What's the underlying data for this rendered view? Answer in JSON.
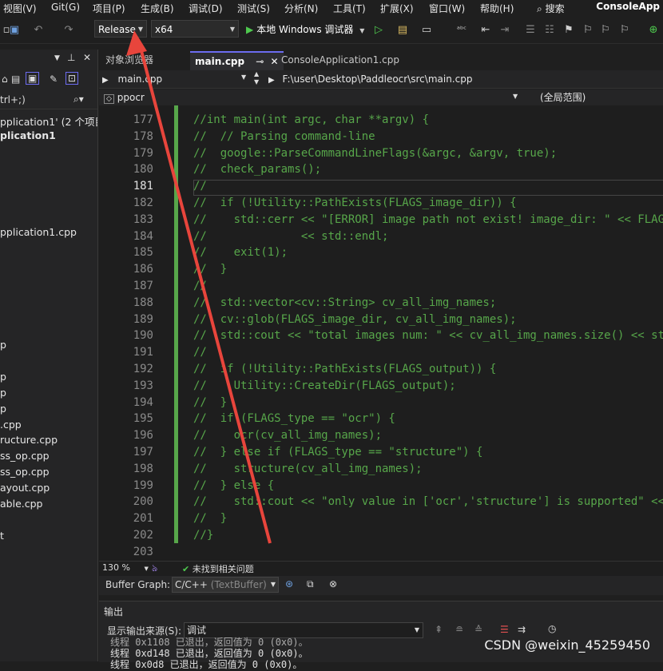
{
  "menu": {
    "items": [
      "视图(V)",
      "Git(G)",
      "项目(P)",
      "生成(B)",
      "调试(D)",
      "测试(S)",
      "分析(N)",
      "工具(T)",
      "扩展(X)",
      "窗口(W)",
      "帮助(H)"
    ],
    "search": "搜索",
    "app_title": "ConsoleApp"
  },
  "toolbar": {
    "config": "Release",
    "platform": "x64",
    "run_label": "本地 Windows 调试器"
  },
  "solution": {
    "search_hint": "trl+;)",
    "rows": [
      "pplication1' (2 个项目",
      "plication1",
      "pplication1.cpp",
      "p",
      "p",
      "p",
      "p",
      ".cpp",
      "ructure.cpp",
      "ss_op.cpp",
      "ss_op.cpp",
      "ayout.cpp",
      "able.cpp",
      "t"
    ]
  },
  "tabs": {
    "object_browser": "对象浏览器",
    "main": "main.cpp",
    "console": "ConsoleApplication1.cpp"
  },
  "nav": {
    "file": "main.cpp",
    "path": "F:\\user\\Desktop\\Paddleocr\\src\\main.cpp",
    "scope_left": "ppocr",
    "scope_right": "(全局范围)"
  },
  "editor": {
    "current_line": "181",
    "lines": [
      {
        "n": "177",
        "t": "//int main(int argc, char **argv) {"
      },
      {
        "n": "178",
        "t": "//  // Parsing command-line"
      },
      {
        "n": "179",
        "t": "//  google::ParseCommandLineFlags(&argc, &argv, true);"
      },
      {
        "n": "180",
        "t": "//  check_params();"
      },
      {
        "n": "181",
        "t": "//"
      },
      {
        "n": "182",
        "t": "//  if (!Utility::PathExists(FLAGS_image_dir)) {"
      },
      {
        "n": "183",
        "t": "//    std::cerr << \"[ERROR] image path not exist! image_dir: \" << FLAG"
      },
      {
        "n": "184",
        "t": "//              << std::endl;"
      },
      {
        "n": "185",
        "t": "//    exit(1);"
      },
      {
        "n": "186",
        "t": "//  }"
      },
      {
        "n": "187",
        "t": "//"
      },
      {
        "n": "188",
        "t": "//  std::vector<cv::String> cv_all_img_names;"
      },
      {
        "n": "189",
        "t": "//  cv::glob(FLAGS_image_dir, cv_all_img_names);"
      },
      {
        "n": "190",
        "t": "//  std::cout << \"total images num: \" << cv_all_img_names.size() << st"
      },
      {
        "n": "191",
        "t": "//"
      },
      {
        "n": "192",
        "t": "//  if (!Utility::PathExists(FLAGS_output)) {"
      },
      {
        "n": "193",
        "t": "//    Utility::CreateDir(FLAGS_output);"
      },
      {
        "n": "194",
        "t": "//  }"
      },
      {
        "n": "195",
        "t": "//  if (FLAGS_type == \"ocr\") {"
      },
      {
        "n": "196",
        "t": "//    ocr(cv_all_img_names);"
      },
      {
        "n": "197",
        "t": "//  } else if (FLAGS_type == \"structure\") {"
      },
      {
        "n": "198",
        "t": "//    structure(cv_all_img_names);"
      },
      {
        "n": "199",
        "t": "//  } else {"
      },
      {
        "n": "200",
        "t": "//    std::cout << \"only value in ['ocr','structure'] is supported\" <<"
      },
      {
        "n": "201",
        "t": "//  }"
      },
      {
        "n": "202",
        "t": "//}"
      },
      {
        "n": "203",
        "t": ""
      }
    ]
  },
  "status": {
    "zoom": "130 %",
    "issues": "未找到相关问题"
  },
  "buffer": {
    "label": "Buffer Graph:",
    "value": "C/C++",
    "value_hint": "(TextBuffer)"
  },
  "output": {
    "title": "输出",
    "source_label": "显示输出来源(S):",
    "source_value": "调试",
    "lines": [
      "线程 0x1108 已退出，返回值为 0 (0x0)。",
      "线程 0xd148 已退出，返回值为 0 (0x0)。",
      "线程 0x0d8 已退出，返回值为 0 (0x0)。"
    ]
  },
  "watermark": "CSDN @weixin_45259450",
  "colors": {
    "comment": "#57a64a",
    "accent": "#6c6cf0",
    "annotation_arrow": "#e8453c"
  }
}
